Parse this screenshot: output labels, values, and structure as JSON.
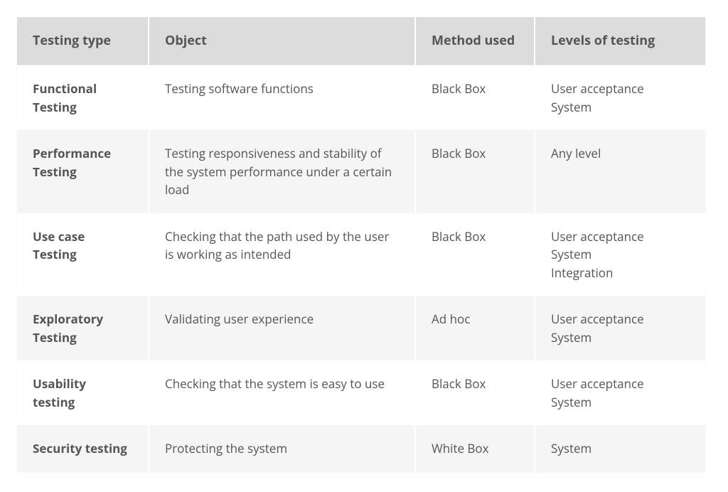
{
  "headers": {
    "type": "Testing type",
    "object": "Object",
    "method": "Method used",
    "levels": "Levels of testing"
  },
  "rows": [
    {
      "type": "Functional Testing",
      "object": "Testing software functions",
      "method": "Black Box",
      "levels": [
        "User acceptance",
        "System"
      ]
    },
    {
      "type": "Performance Testing",
      "object": "Testing responsiveness and stability of the system performance under a certain load",
      "method": "Black Box",
      "levels": [
        "Any level"
      ]
    },
    {
      "type": "Use case Testing",
      "object": "Checking that the path used by the user is working as intended",
      "method": "Black Box",
      "levels": [
        "User acceptance",
        "System",
        "Integration"
      ]
    },
    {
      "type": "Exploratory Testing",
      "object": "Validating user experience",
      "method": "Ad hoc",
      "levels": [
        "User acceptance",
        "System"
      ]
    },
    {
      "type": "Usability testing",
      "object": "Checking that the system is easy to use",
      "method": "Black Box",
      "levels": [
        "User acceptance",
        "System"
      ]
    },
    {
      "type": "Security testing",
      "object": "Protecting the system",
      "method": "White Box",
      "levels": [
        "System"
      ]
    }
  ]
}
